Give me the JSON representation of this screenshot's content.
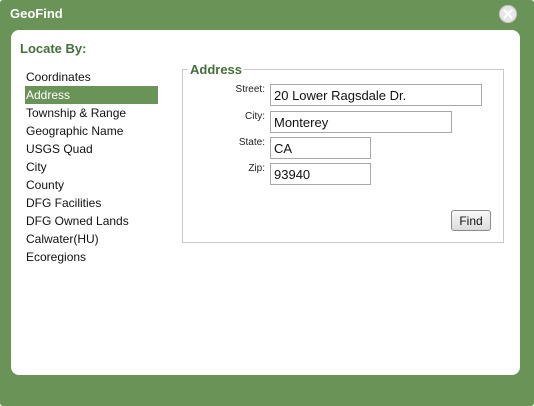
{
  "window": {
    "title": "GeoFind",
    "close_icon": "close-icon"
  },
  "locate_by": {
    "heading": "Locate By:",
    "items": [
      {
        "label": "Coordinates",
        "selected": false
      },
      {
        "label": "Address",
        "selected": true
      },
      {
        "label": "Township & Range",
        "selected": false
      },
      {
        "label": "Geographic Name",
        "selected": false
      },
      {
        "label": "USGS Quad",
        "selected": false
      },
      {
        "label": "City",
        "selected": false
      },
      {
        "label": "County",
        "selected": false
      },
      {
        "label": "DFG Facilities",
        "selected": false
      },
      {
        "label": "DFG Owned Lands",
        "selected": false
      },
      {
        "label": "Calwater(HU)",
        "selected": false
      },
      {
        "label": "Ecoregions",
        "selected": false
      }
    ]
  },
  "address_form": {
    "legend": "Address",
    "street": {
      "label": "Street:",
      "value": "20 Lower Ragsdale Dr."
    },
    "city": {
      "label": "City:",
      "value": "Monterey"
    },
    "state": {
      "label": "State:",
      "value": "CA"
    },
    "zip": {
      "label": "Zip:",
      "value": "93940"
    },
    "find_label": "Find"
  },
  "colors": {
    "frame": "#6a9357",
    "heading": "#44703a",
    "selection": "#6a9357"
  }
}
